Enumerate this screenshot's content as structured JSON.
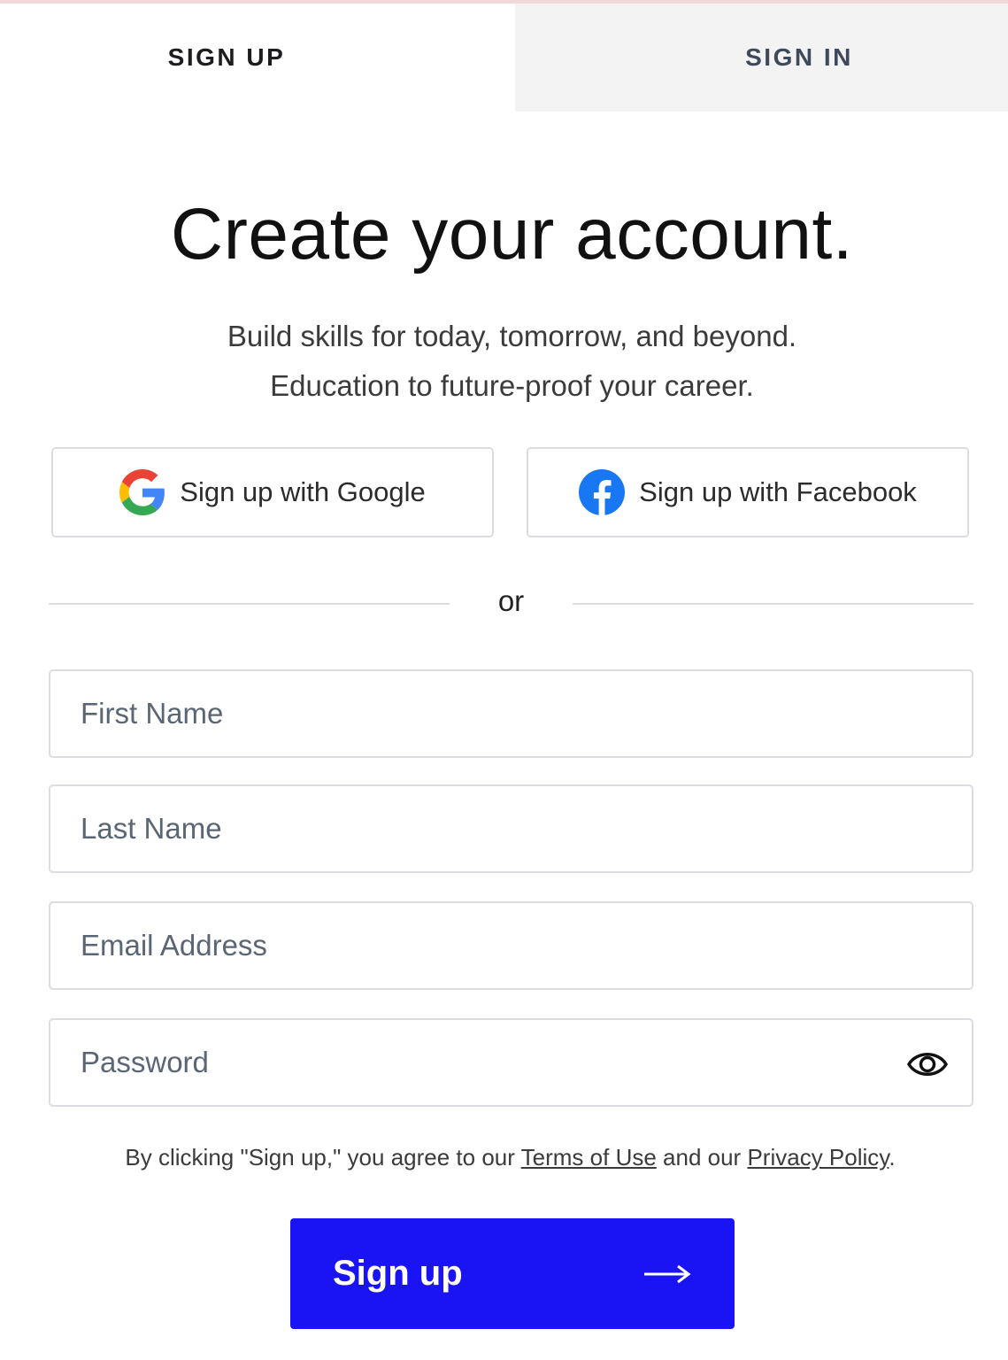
{
  "tabs": {
    "sign_up": "SIGN UP",
    "sign_in": "SIGN IN"
  },
  "header": {
    "title": "Create your account.",
    "subtitle_line1": "Build skills for today, tomorrow, and beyond.",
    "subtitle_line2": "Education to future-proof your career."
  },
  "social": {
    "google_label": "Sign up with Google",
    "google_icon": "google-logo-icon",
    "facebook_label": "Sign up with Facebook",
    "facebook_icon": "facebook-logo-icon"
  },
  "divider": {
    "text": "or"
  },
  "form": {
    "first_name_placeholder": "First Name",
    "last_name_placeholder": "Last Name",
    "email_placeholder": "Email Address",
    "password_placeholder": "Password",
    "password_toggle_icon": "eye-icon"
  },
  "legal": {
    "prefix": "By clicking \"Sign up,\" you agree to our ",
    "terms": "Terms of Use",
    "middle": " and our ",
    "privacy": "Privacy Policy",
    "suffix": "."
  },
  "submit": {
    "label": "Sign up",
    "arrow_icon": "arrow-right-icon"
  },
  "colors": {
    "accent": "#1a14f5",
    "facebook": "#1877f2",
    "tab_inactive_bg": "#f3f3f3",
    "border": "#dcdde2"
  }
}
